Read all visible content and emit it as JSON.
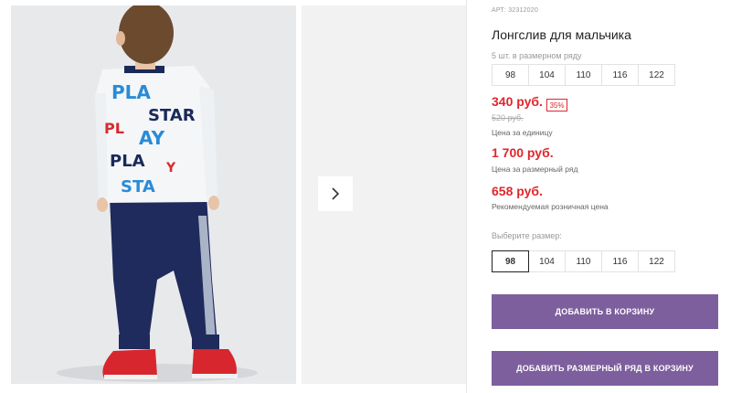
{
  "product": {
    "art": "АРТ: 32312020",
    "title": "Лонгслив для мальчика",
    "pack_label": "5 шт. в размерном ряду",
    "pack_sizes": [
      "98",
      "104",
      "110",
      "116",
      "122"
    ],
    "price_unit": "340 руб.",
    "discount": "35%",
    "old_price": "520 руб.",
    "price_unit_note": "Цена за единицу",
    "price_pack": "1 700 руб.",
    "price_pack_note": "Цена за размерный ряд",
    "price_retail": "658 руб.",
    "price_retail_note": "Рекомендуемая розничная цена",
    "select_size_label": "Выберите размер:",
    "select_sizes": [
      "98",
      "104",
      "110",
      "116",
      "122"
    ],
    "selected_size": "98",
    "add_to_cart_label": "ДОБАВИТЬ В КОРЗИНУ",
    "add_pack_label": "ДОБАВИТЬ РАЗМЕРНЫЙ РЯД В КОРЗИНУ"
  },
  "gallery": {
    "next_icon": "chevron-right-icon"
  },
  "colors": {
    "accent_button": "#7d5f9d",
    "price_red": "#e0262b"
  }
}
